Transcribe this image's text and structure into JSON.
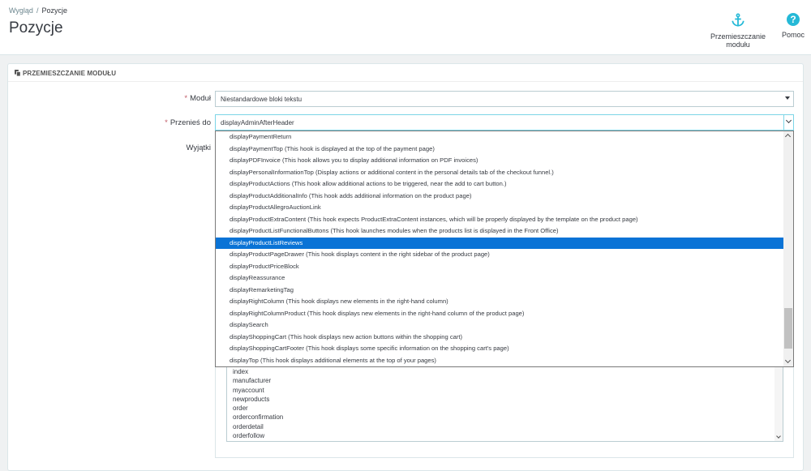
{
  "breadcrumb": {
    "parent": "Wygląd",
    "separator": "/",
    "current": "Pozycje"
  },
  "page_title": "Pozycje",
  "toolbar": {
    "move_label": "Przemieszczanie modułu",
    "help_label": "Pomoc",
    "help_glyph": "?"
  },
  "panel": {
    "heading": "PRZEMIESZCZANIE MODUŁU"
  },
  "form": {
    "module_label": "Moduł",
    "module_value": "Niestandardowe bloki tekstu",
    "hook_label": "Przenieś do",
    "hook_value": "displayAdminAfterHeader",
    "exceptions_label": "Wyjątki",
    "required_mark": "*"
  },
  "hook_options": [
    "displayPaymentReturn",
    "displayPaymentTop (This hook is displayed at the top of the payment page)",
    "displayPDFInvoice (This hook allows you to display additional information on PDF invoices)",
    "displayPersonalInformationTop (Display actions or additional content in the personal details tab of the checkout funnel.)",
    "displayProductActions (This hook allow additional actions to be triggered, near the add to cart button.)",
    "displayProductAdditionalInfo (This hook adds additional information on the product page)",
    "displayProductAllegroAuctionLink",
    "displayProductExtraContent (This hook expects ProductExtraContent instances, which will be properly displayed by the template on the product page)",
    "displayProductListFunctionalButtons (This hook launches modules when the products list is displayed in the Front Office)",
    "displayProductListReviews",
    "displayProductPageDrawer (This hook displays content in the right sidebar of the product page)",
    "displayProductPriceBlock",
    "displayReassurance",
    "displayRemarketingTag",
    "displayRightColumn (This hook displays new elements in the right-hand column)",
    "displayRightColumnProduct (This hook displays new elements in the right-hand column of the product page)",
    "displaySearch",
    "displayShoppingCart (This hook displays new action buttons within the shopping cart)",
    "displayShoppingCartFooter (This hook displays some specific information on the shopping cart's page)",
    "displayTop (This hook displays additional elements at the top of your pages)"
  ],
  "highlighted_option": "displayProductListReviews",
  "exceptions": [
    "index",
    "manufacturer",
    "myaccount",
    "newproducts",
    "order",
    "orderconfirmation",
    "orderdetail",
    "orderfollow"
  ],
  "colors": {
    "accent": "#25b9d7",
    "selection": "#0a73d6",
    "required": "#c05c67"
  }
}
